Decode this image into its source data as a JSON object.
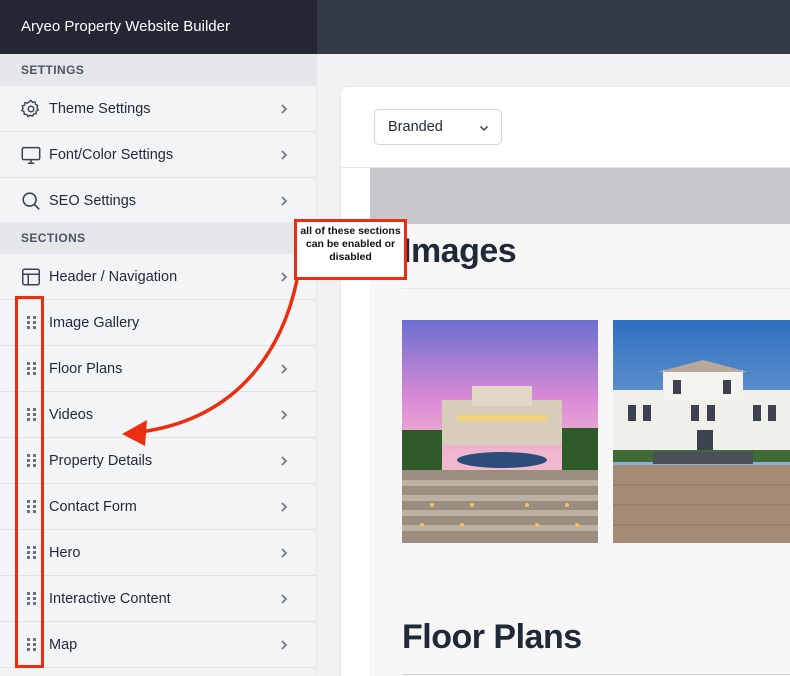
{
  "app": {
    "title": "Aryeo Property Website Builder"
  },
  "sidebar": {
    "settings_header": "SETTINGS",
    "settings_items": [
      {
        "label": "Theme Settings",
        "icon": "gear-icon"
      },
      {
        "label": "Font/Color Settings",
        "icon": "monitor-icon"
      },
      {
        "label": "SEO Settings",
        "icon": "search-icon"
      }
    ],
    "sections_header": "SECTIONS",
    "header_nav": {
      "label": "Header / Navigation",
      "icon": "layout-icon"
    },
    "section_items": [
      {
        "label": "Image Gallery",
        "icon": "drag-handle-icon"
      },
      {
        "label": "Floor Plans",
        "icon": "drag-handle-icon"
      },
      {
        "label": "Videos",
        "icon": "drag-handle-icon"
      },
      {
        "label": "Property Details",
        "icon": "drag-handle-icon"
      },
      {
        "label": "Contact Form",
        "icon": "drag-handle-icon"
      },
      {
        "label": "Hero",
        "icon": "drag-handle-icon"
      },
      {
        "label": "Interactive Content",
        "icon": "drag-handle-icon"
      },
      {
        "label": "Map",
        "icon": "drag-handle-icon"
      }
    ]
  },
  "main": {
    "branding_select": {
      "value": "Branded"
    },
    "preview": {
      "images_heading": "Images",
      "floor_plans_heading": "Floor Plans"
    }
  },
  "annotation": {
    "text": "all of these sections can be enabled or disabled",
    "color": "#ea2e0f"
  }
}
